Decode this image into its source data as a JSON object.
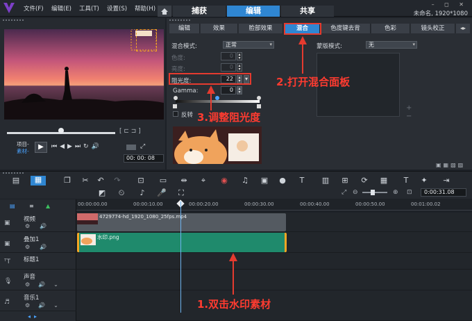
{
  "menu": {
    "file": "文件(F)",
    "edit": "编辑(E)",
    "tools": "工具(T)",
    "settings": "设置(S)",
    "help": "帮助(H)"
  },
  "tabs": {
    "capture": "捕获",
    "edit": "编辑",
    "share": "共享"
  },
  "doc_title": "未命名, 1920*1080",
  "preview": {
    "project_label": "项目-",
    "clip_label": "素材-",
    "timecode": "00: 00: 08"
  },
  "options": {
    "subtabs": [
      "编辑",
      "效果",
      "脸部效果",
      "混合",
      "色度键去背",
      "色彩",
      "镜头校正"
    ],
    "blend_mode_label": "混合模式:",
    "blend_mode_value": "正常",
    "mask_mode_label": "蒙版模式:",
    "mask_mode_value": "无",
    "hue_label": "色度:",
    "hue_value": "0",
    "brightness_label": "亮度:",
    "brightness_value": "0",
    "opacity_label": "阻光度:",
    "opacity_value": "22",
    "gamma_label": "Gamma:",
    "gamma_value": "0",
    "invert_label": "反转"
  },
  "annotations": {
    "step1": "1.双击水印素材",
    "step2": "2.打开混合面板",
    "step3": "3.调整阻光度"
  },
  "timeline": {
    "ruler_timecode": "0:00:31.08",
    "ticks": [
      "00:00:00.00",
      "00:00:10.00",
      "00:00:20.00",
      "00:00:30.00",
      "00:00:40.00",
      "00:00:50.00",
      "00:01:00.02"
    ],
    "tracks": [
      {
        "name": "视频"
      },
      {
        "name": "叠加1"
      },
      {
        "name": "标题1"
      },
      {
        "name": "声音"
      },
      {
        "name": "音乐1"
      }
    ],
    "video_clip": "4729774-hd_1920_1080_25fps.mp4",
    "overlay_clip": "水印.png"
  },
  "colors": {
    "accent": "#2f86d2",
    "annotation": "#e53b2f",
    "overlay_clip": "#1f8a6c",
    "video_clip": "#545a61"
  }
}
